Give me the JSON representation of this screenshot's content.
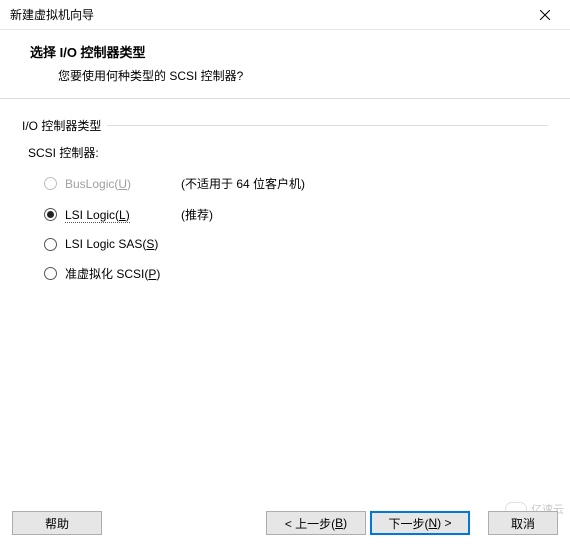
{
  "window": {
    "title": "新建虚拟机向导"
  },
  "header": {
    "title": "选择 I/O 控制器类型",
    "subtitle": "您要使用何种类型的 SCSI 控制器?"
  },
  "group": {
    "label": "I/O 控制器类型",
    "scsi_label": "SCSI 控制器:"
  },
  "options": {
    "buslogic": {
      "pre": "BusLogic(",
      "accel": "U",
      "post": ")",
      "hint": "(不适用于 64 位客户机)"
    },
    "lsilogic": {
      "pre": "LSI Logic(",
      "accel": "L",
      "post": ")",
      "hint": "(推荐)"
    },
    "lsisas": {
      "pre": "LSI Logic SAS(",
      "accel": "S",
      "post": ")"
    },
    "paravirt": {
      "pre": "准虚拟化 SCSI(",
      "accel": "P",
      "post": ")"
    }
  },
  "buttons": {
    "help": "帮助",
    "back_pre": "< 上一步(",
    "back_accel": "B",
    "back_post": ")",
    "next_pre": "下一步(",
    "next_accel": "N",
    "next_post": ") >",
    "cancel": "取消"
  },
  "watermark": {
    "text": "亿速云"
  }
}
